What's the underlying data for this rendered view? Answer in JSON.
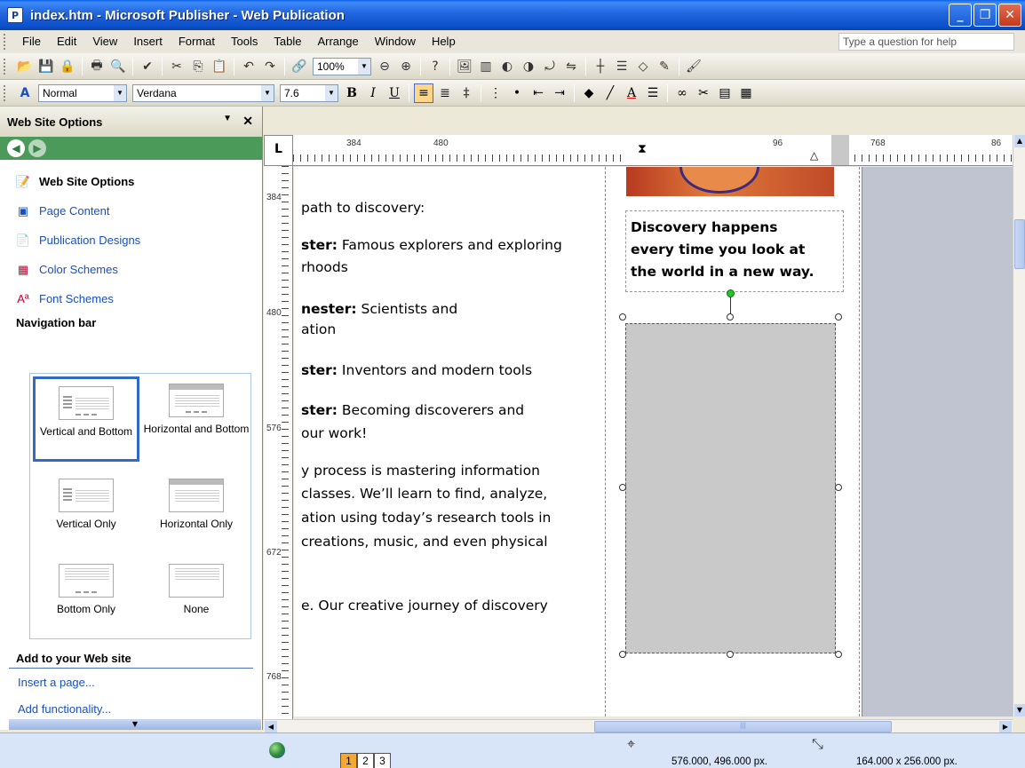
{
  "window": {
    "title": "index.htm - Microsoft Publisher - Web Publication",
    "minimize_label": "_",
    "restore_label": "❐",
    "close_label": "✕"
  },
  "menu": {
    "items": [
      "File",
      "Edit",
      "View",
      "Insert",
      "Format",
      "Tools",
      "Table",
      "Arrange",
      "Window",
      "Help"
    ],
    "help_placeholder": "Type a question for help"
  },
  "standard_toolbar": {
    "zoom": "100%"
  },
  "format_toolbar": {
    "style": "Normal",
    "font": "Verdana",
    "size": "7.6"
  },
  "task_pane": {
    "title": "Web Site Options",
    "links": [
      {
        "label": "Web Site Options",
        "icon": "website-options-icon"
      },
      {
        "label": "Page Content",
        "icon": "page-content-icon"
      },
      {
        "label": "Publication Designs",
        "icon": "publication-designs-icon"
      },
      {
        "label": "Color Schemes",
        "icon": "color-schemes-icon"
      },
      {
        "label": "Font Schemes",
        "icon": "font-schemes-icon"
      }
    ],
    "navbar_section": "Navigation bar",
    "navbar_options": [
      "Vertical and Bottom",
      "Horizontal and Bottom",
      "Vertical Only",
      "Horizontal Only",
      "Bottom Only",
      "None"
    ],
    "navbar_selected": "Vertical and Bottom",
    "add_section": "Add to your Web site",
    "add_links": [
      "Insert a page...",
      "Add functionality..."
    ]
  },
  "rulers": {
    "corner": "L",
    "h_labels": [
      "384",
      "480",
      "96",
      "768",
      "86"
    ],
    "v_labels": [
      "384",
      "480",
      "576",
      "672",
      "768"
    ]
  },
  "document": {
    "lines": [
      {
        "bold": "",
        "text": "path to discovery:"
      },
      {
        "bold": "ster:",
        "text": " Famous explorers and exploring"
      },
      {
        "bold": "",
        "text": "rhoods"
      },
      {
        "bold": "nester:",
        "text": " Scientists and"
      },
      {
        "bold": "",
        "text": "ation"
      },
      {
        "bold": "ster:",
        "text": " Inventors and modern tools"
      },
      {
        "bold": "ster:",
        "text": " Becoming discoverers and"
      },
      {
        "bold": "",
        "text": "our work!"
      },
      {
        "bold": "",
        "text": "y process is mastering information"
      },
      {
        "bold": "",
        "text": "classes. We’ll learn to find, analyze,"
      },
      {
        "bold": "",
        "text": "ation using today’s research tools in"
      },
      {
        "bold": "",
        "text": "creations, music, and even physical"
      },
      {
        "bold": "",
        "text": "e. Our creative journey of discovery"
      }
    ],
    "quote": [
      "Discovery happens",
      "every time you look at",
      "the world in a new way."
    ]
  },
  "status": {
    "pages": [
      "1",
      "2",
      "3"
    ],
    "active_page": "1",
    "position": "576.000, 496.000 px.",
    "size": "164.000 x 256.000 px."
  }
}
